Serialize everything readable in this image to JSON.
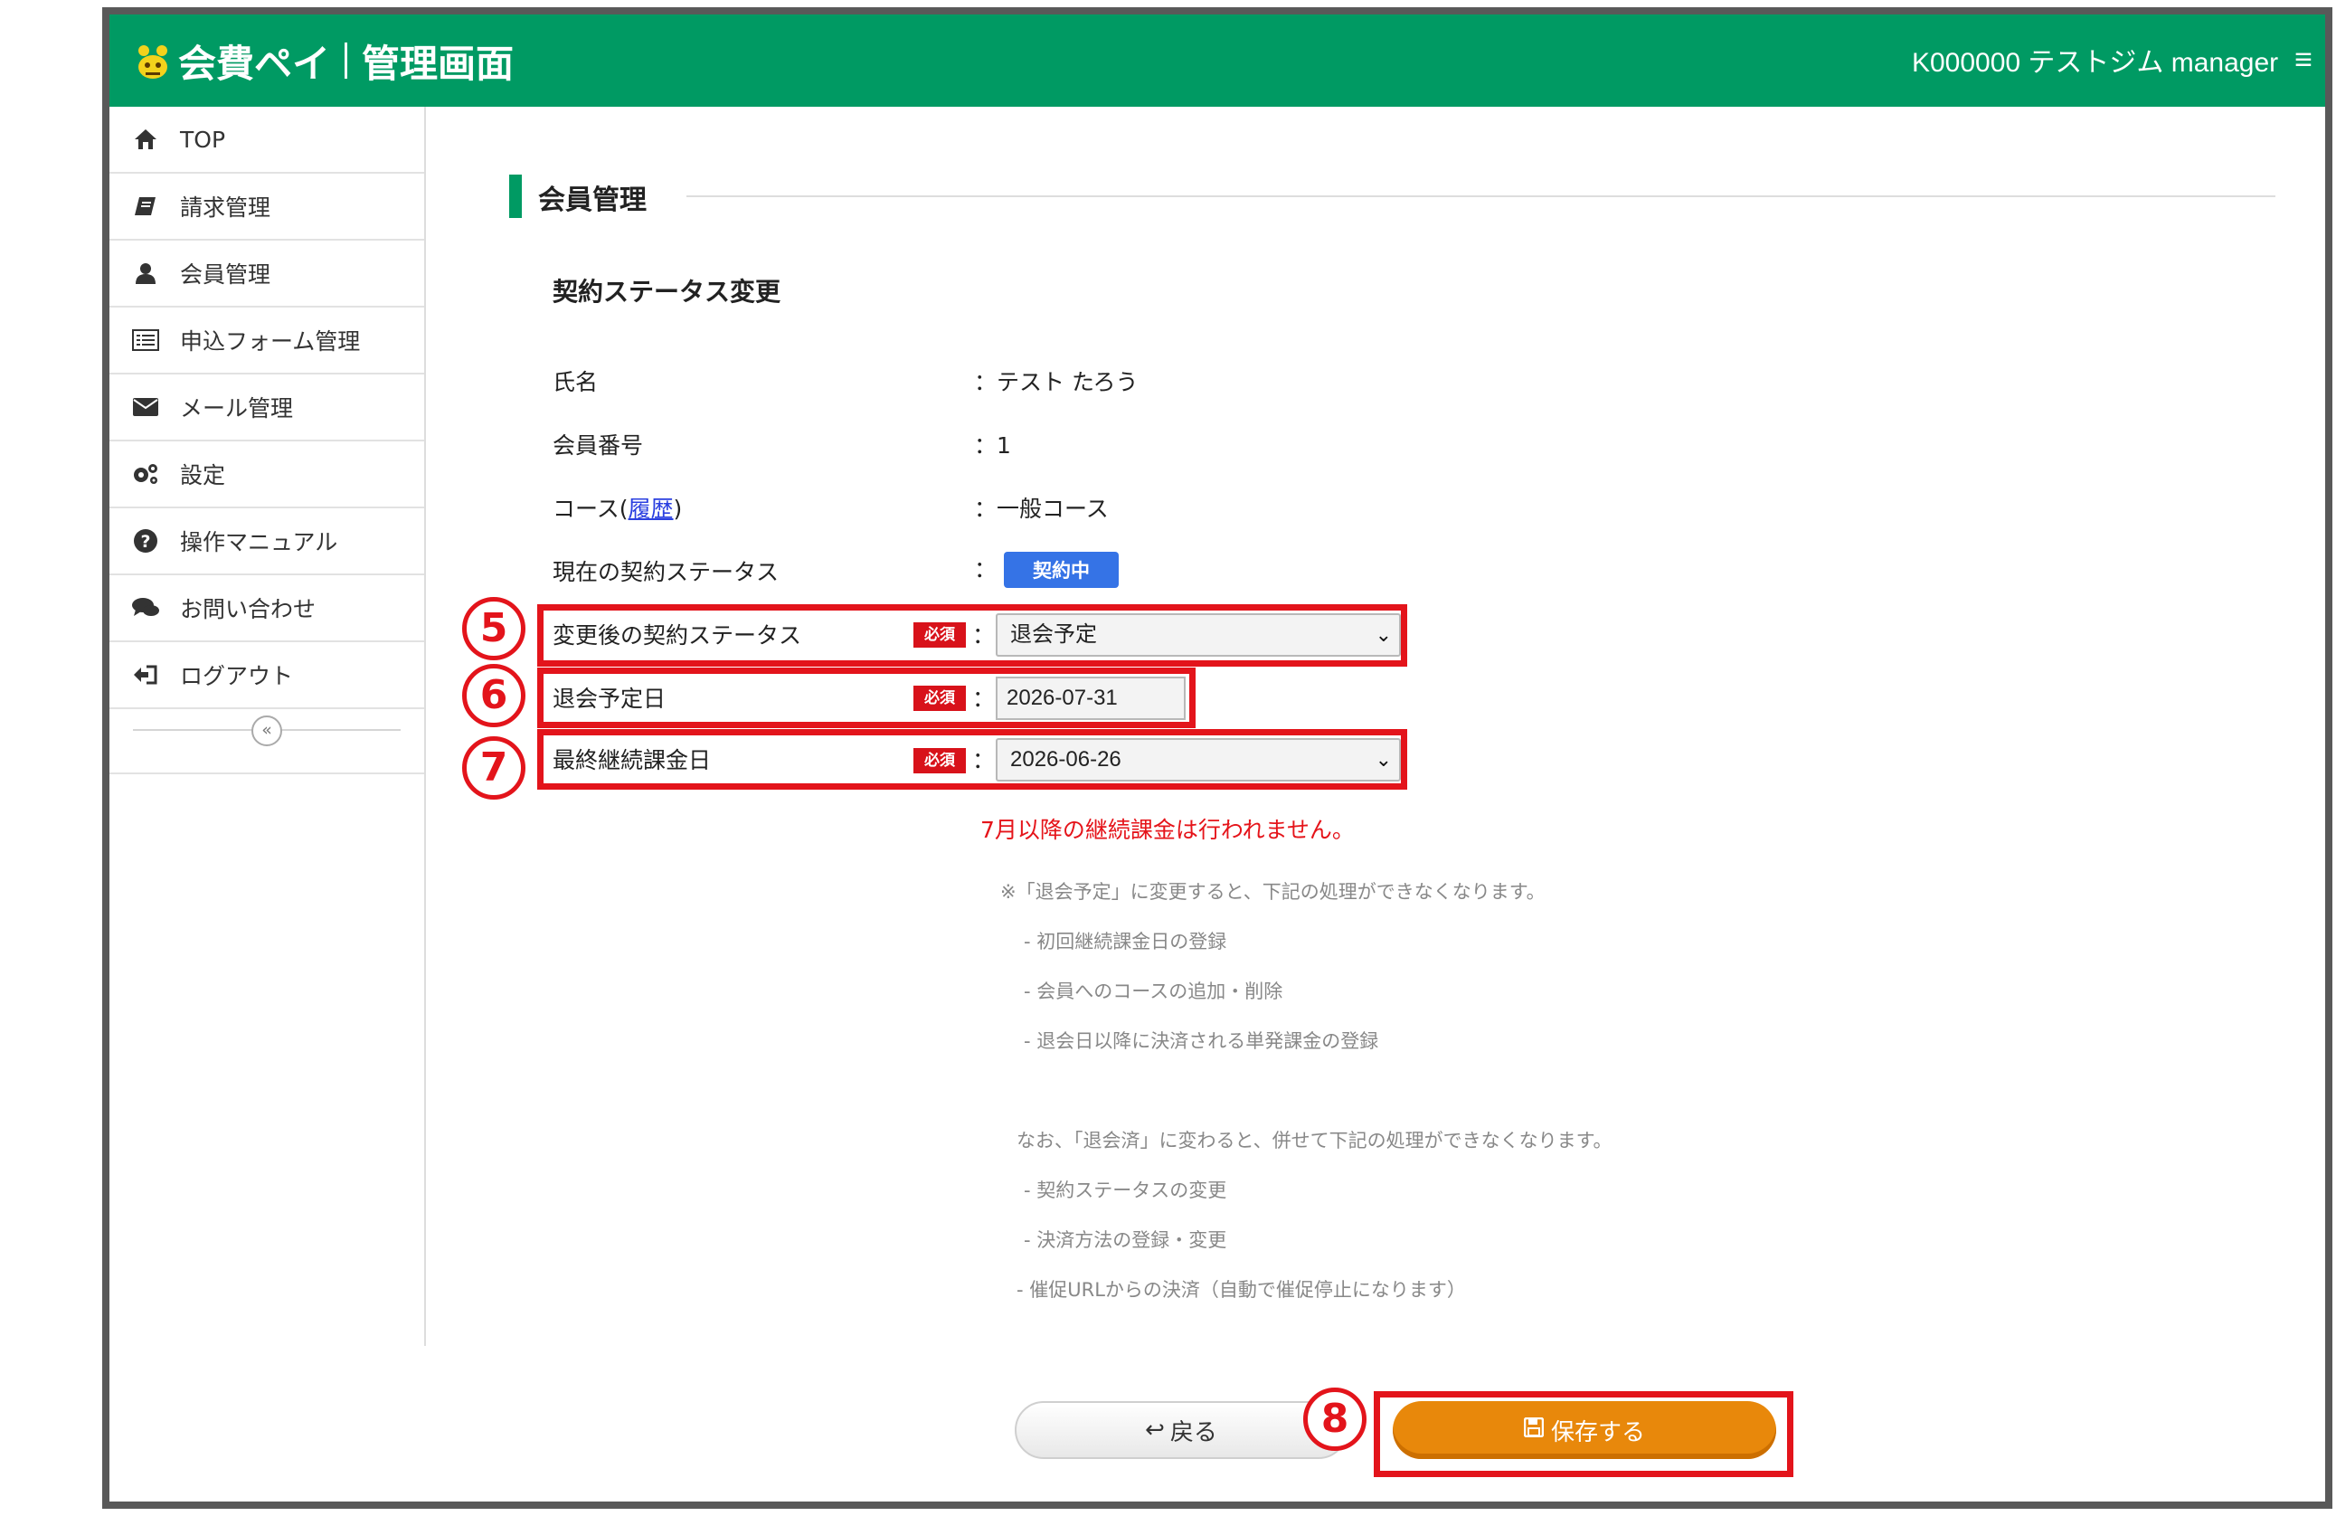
{
  "header": {
    "app_name": "会費ペイ",
    "app_section": "管理画面",
    "account": "K000000 テストジム manager",
    "menu_icon": "hamburger-icon",
    "brand_color": "#009a63"
  },
  "sidebar": {
    "items": [
      {
        "label": "TOP",
        "icon": "home-icon"
      },
      {
        "label": "請求管理",
        "icon": "book-icon"
      },
      {
        "label": "会員管理",
        "icon": "user-icon"
      },
      {
        "label": "申込フォーム管理",
        "icon": "form-list-icon"
      },
      {
        "label": "メール管理",
        "icon": "envelope-icon"
      },
      {
        "label": "設定",
        "icon": "gears-icon"
      },
      {
        "label": "操作マニュアル",
        "icon": "question-icon"
      },
      {
        "label": "お問い合わせ",
        "icon": "chat-icon"
      },
      {
        "label": "ログアウト",
        "icon": "logout-icon"
      }
    ],
    "collapse_symbol": "«"
  },
  "page": {
    "section_title": "会員管理",
    "sub_title": "契約ステータス変更"
  },
  "member": {
    "name_label": "氏名",
    "name_value": "：テスト たろう",
    "number_label": "会員番号",
    "number_value": "：1",
    "course_label_prefix": "コース(",
    "course_history_link": "履歴",
    "course_label_suffix": ")",
    "course_value": "：一般コース",
    "status_label": "現在の契約ステータス",
    "status_colon": "：",
    "status_badge": "契約中",
    "status_badge_color": "#3573e6"
  },
  "form": {
    "required_label": "必須",
    "colon": "：",
    "new_status_label": "変更後の契約ステータス",
    "new_status_value": "退会予定",
    "withdraw_date_label": "退会予定日",
    "withdraw_date_value": "2026-07-31",
    "last_billing_label": "最終継続課金日",
    "last_billing_value": "2026-06-26",
    "warning": "7月以降の継続課金は行われません。"
  },
  "notes": {
    "line1": "※「退会予定」に変更すると、下記の処理ができなくなります。",
    "line2": "- 初回継続課金日の登録",
    "line3": "- 会員へのコースの追加・削除",
    "line4": "- 退会日以降に決済される単発課金の登録",
    "line5": "なお、「退会済」に変わると、併せて下記の処理ができなくなります。",
    "line6": "- 契約ステータスの変更",
    "line7": "- 決済方法の登録・変更",
    "line8": "- 催促URLからの決済（自動で催促停止になります）"
  },
  "annotations": {
    "step5": "5",
    "step6": "6",
    "step7": "7",
    "step8": "8",
    "highlight_color": "#e3141b"
  },
  "buttons": {
    "back_icon": "undo-arrow-icon",
    "back_label": "戻る",
    "save_icon": "floppy-icon",
    "save_label": "保存する",
    "save_color": "#e8880b"
  }
}
